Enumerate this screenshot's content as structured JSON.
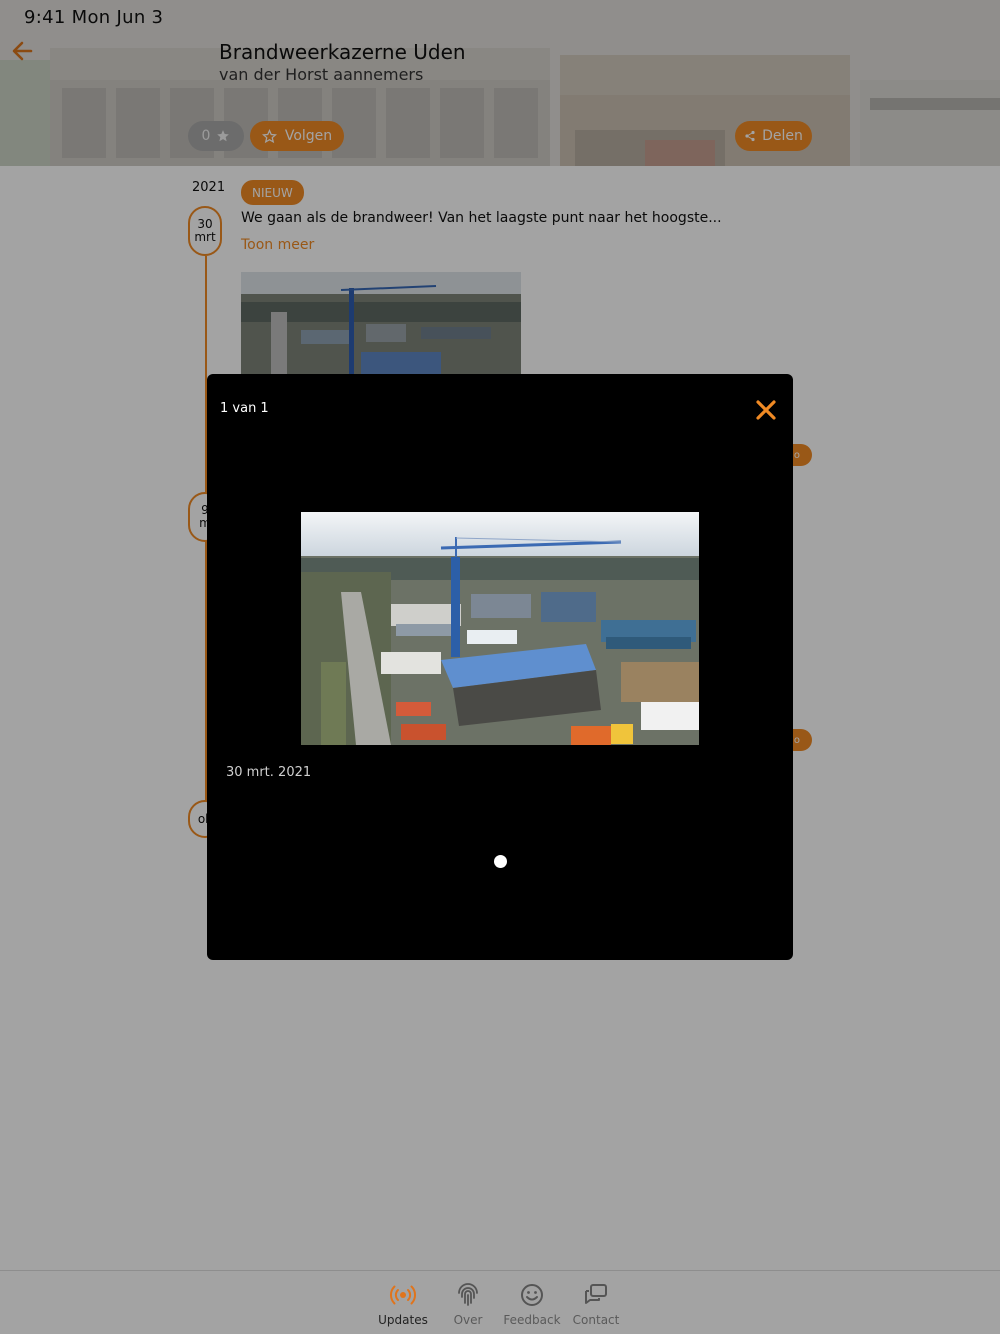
{
  "status_bar": {
    "time": "9:41  Mon Jun 3"
  },
  "header": {
    "title": "Brandweerkazerne Uden",
    "subtitle": "van der Horst aannemers",
    "favorites_count": "0",
    "follow_label": "Volgen",
    "share_label": "Delen"
  },
  "timeline": {
    "year": "2021",
    "first_post": {
      "date_day": "30",
      "date_month": "mrt",
      "badge": "NIEUW",
      "text": "We gaan als de brandweer! Van het laagste punt naar het hoogste...",
      "show_more": "Toon meer"
    },
    "second_post": {
      "date_day": "9",
      "date_month": "m"
    },
    "third_post": {
      "date_day": "ok",
      "date_month": ""
    },
    "side_pill_label": "o"
  },
  "viewer": {
    "counter": "1 van 1",
    "photo_date": "30 mrt. 2021",
    "photo_alt_icon": "construction-site-photo"
  },
  "tabbar": {
    "items": [
      {
        "label": "Updates",
        "icon": "broadcast-icon",
        "active": true
      },
      {
        "label": "Over",
        "icon": "fingerprint-icon",
        "active": false
      },
      {
        "label": "Feedback",
        "icon": "smiley-icon",
        "active": false
      },
      {
        "label": "Contact",
        "icon": "chat-icon",
        "active": false
      }
    ]
  },
  "colors": {
    "accent": "#f08a24",
    "modal_bg": "#000000",
    "tabbar_bg": "#a3a3a3"
  }
}
